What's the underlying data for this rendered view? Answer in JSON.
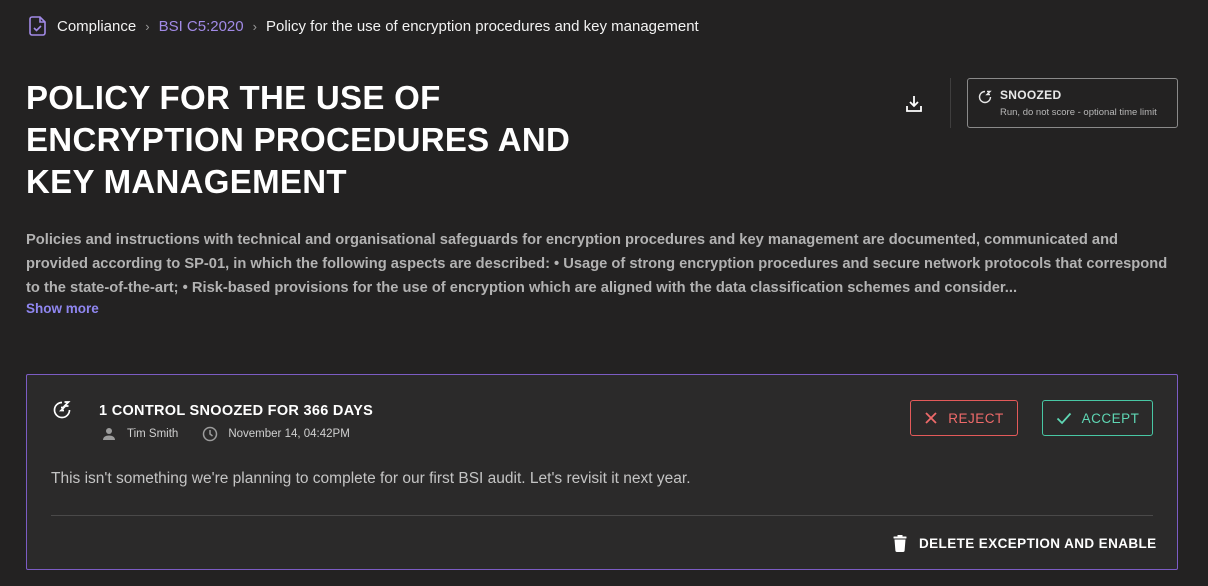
{
  "breadcrumb": {
    "icon": "compliance-document-icon",
    "items": [
      "Compliance",
      "BSI C5:2020",
      "Policy for the use of encryption procedures and key management"
    ],
    "separator": "›"
  },
  "page": {
    "title": "POLICY FOR THE USE OF ENCRYPTION PROCEDURES AND KEY MANAGEMENT",
    "description": "Policies and instructions with technical and organisational safeguards for encryption procedures and key management are documented, communicated and provided according to SP-01, in which the following aspects are described: • Usage of strong encryption procedures and secure network protocols that correspond to the state-of-the-art; • Risk-based provisions for the use of encryption which are aligned with the data classification schemes and consider...",
    "show_more": "Show more"
  },
  "status": {
    "icon": "snooze-icon",
    "label": "SNOOZED",
    "sublabel": "Run, do not score - optional time limit"
  },
  "exception": {
    "icon": "snooze-icon",
    "title": "1 CONTROL SNOOZED FOR 366 DAYS",
    "user": "Tim Smith",
    "timestamp": "November 14, 04:42PM",
    "reject_label": "REJECT",
    "accept_label": "ACCEPT",
    "comment": "This isn't something we're planning to complete for our first BSI audit. Let's revisit it next year.",
    "delete_label": "DELETE EXCEPTION AND ENABLE"
  },
  "colors": {
    "background": "#232222",
    "accent": "#a18ae6",
    "card_border": "#7c5cc4",
    "reject": "#e45a5a",
    "accept": "#48c7a4"
  }
}
